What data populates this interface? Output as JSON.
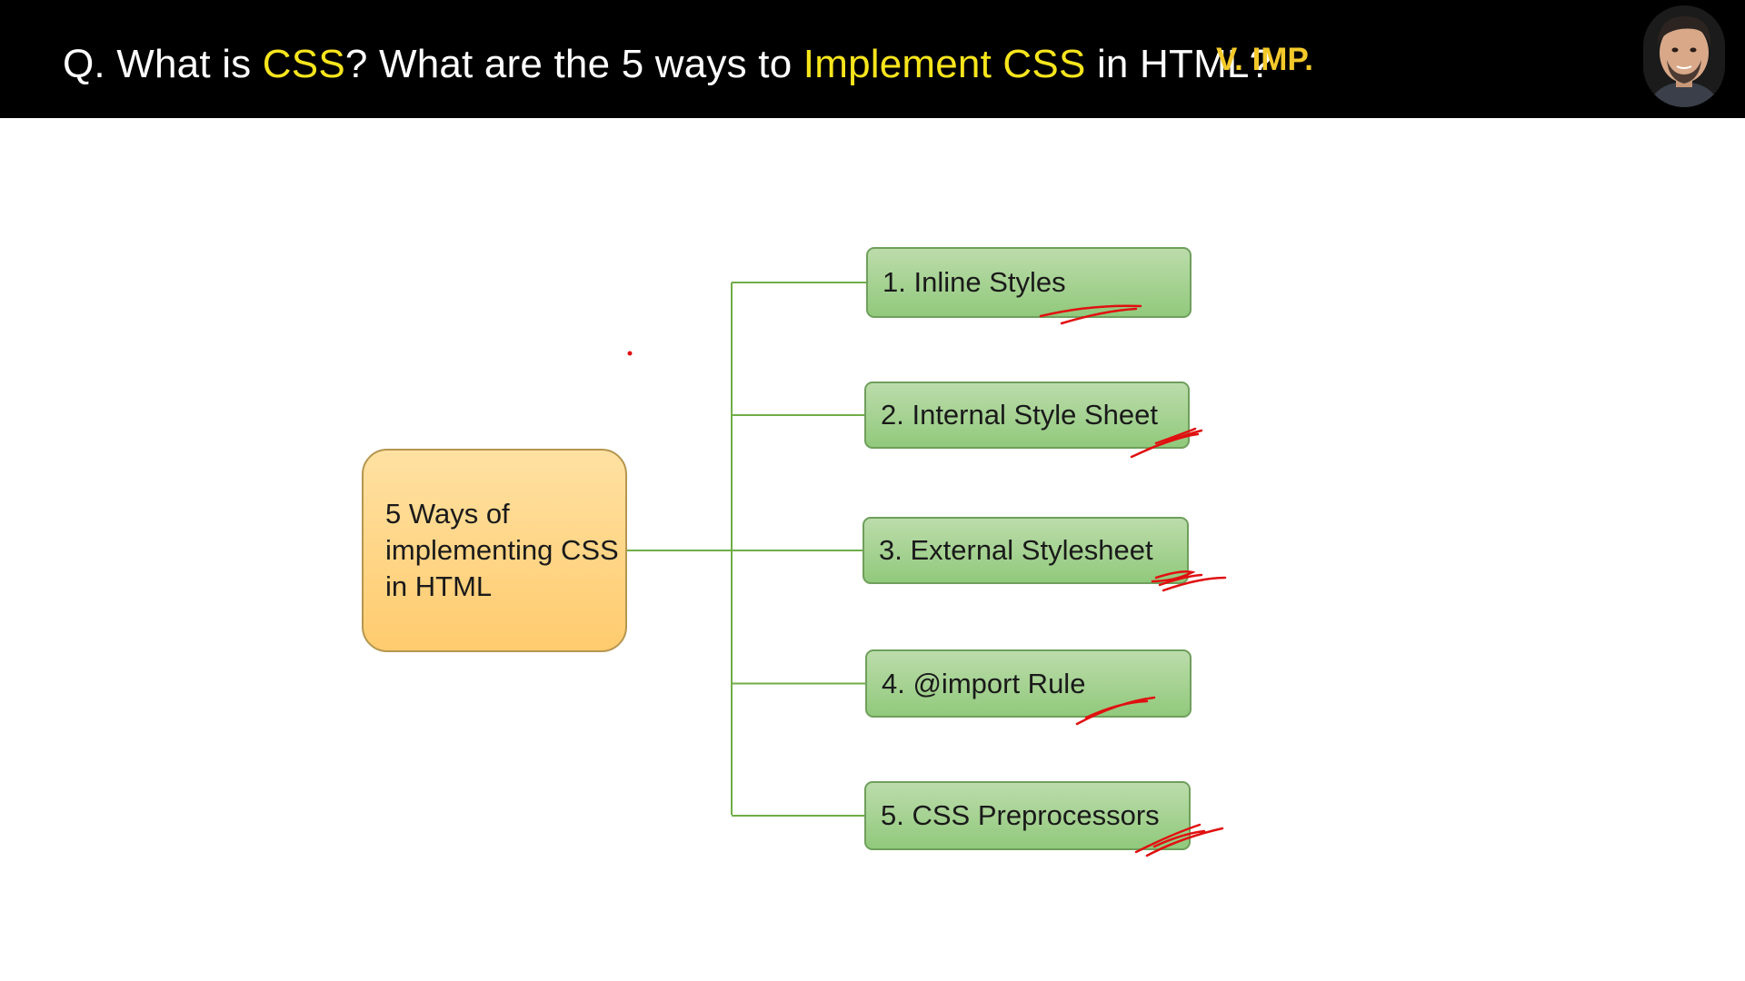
{
  "header": {
    "question_prefix": "Q. What is ",
    "highlight_1": "CSS",
    "question_middle": "? What are the 5 ways to ",
    "highlight_2": "Implement CSS",
    "question_suffix": " in HTML?",
    "badge": "V. IMP."
  },
  "diagram": {
    "center_label": "5 Ways of implementing CSS in HTML",
    "items": [
      {
        "label": "1. Inline Styles"
      },
      {
        "label": "2. Internal Style Sheet"
      },
      {
        "label": "3. External Stylesheet"
      },
      {
        "label": "4. @import Rule"
      },
      {
        "label": "5. CSS Preprocessors"
      }
    ]
  },
  "colors": {
    "header_bg": "#000000",
    "highlight": "#f7e51c",
    "badge": "#f3c92a",
    "center_fill": "#ffcb6e",
    "item_fill": "#a9d496",
    "connector": "#70ad47",
    "annotation": "#e01010"
  }
}
